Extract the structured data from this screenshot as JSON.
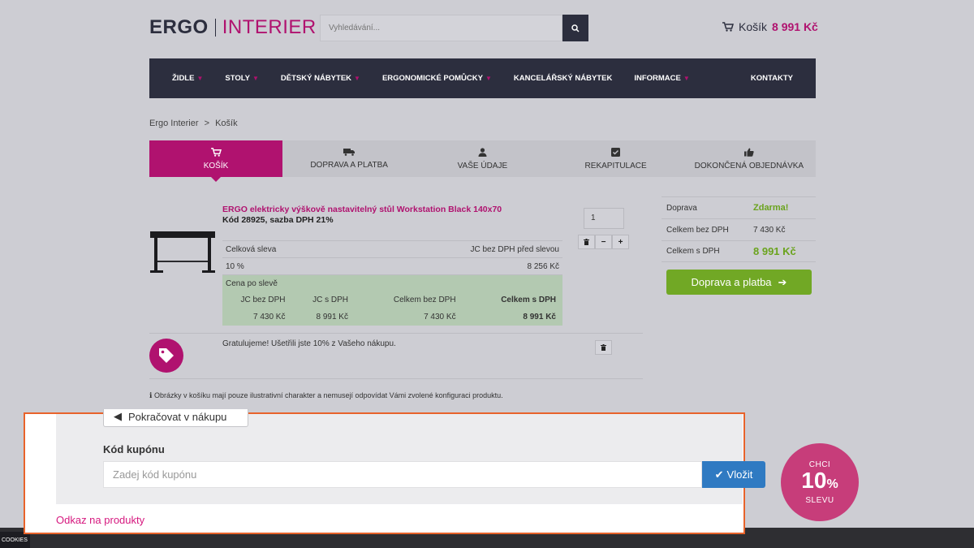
{
  "header": {
    "logo_left": "ERGO",
    "logo_right": "INTERIER",
    "search_placeholder": "Vyhledávání...",
    "cart_label": "Košík",
    "cart_amount": "8 991 Kč"
  },
  "nav": {
    "items": [
      "ŽIDLE",
      "STOLY",
      "DĚTSKÝ NÁBYTEK",
      "ERGONOMICKÉ POMŮCKY",
      "KANCELÁŘSKÝ NÁBYTEK",
      "INFORMACE",
      "KONTAKTY"
    ]
  },
  "breadcrumb": {
    "home": "Ergo Interier",
    "sep": ">",
    "current": "Košík"
  },
  "steps": [
    "KOŠÍK",
    "DOPRAVA A PLATBA",
    "VAŠE ÚDAJE",
    "REKAPITULACE",
    "DOKONČENÁ OBJEDNÁVKA"
  ],
  "product": {
    "title": "ERGO elektricky výškově nastavitelný stůl Workstation Black 140x70",
    "code": "Kód 28925, sazba DPH 21%",
    "quantity": "1",
    "discount_label": "Celková sleva",
    "price_before_label": "JC bez DPH před slevou",
    "discount_value": "10 %",
    "price_before_value": "8 256 Kč",
    "after_label": "Cena po slevě",
    "col1": "JC bez DPH",
    "col2": "JC s DPH",
    "col3": "Celkem bez DPH",
    "col4": "Celkem s DPH",
    "val1": "7 430 Kč",
    "val2": "8 991 Kč",
    "val3": "7 430 Kč",
    "val4": "8 991 Kč"
  },
  "coupon_message": "Gratulujeme! Ušetřili jste 10% z Vašeho nákupu.",
  "note": "Obrázky v košíku mají pouze ilustrativní charakter a nemusejí odpovídat Vámi zvolené konfiguraci produktu.",
  "summary": {
    "shipping_label": "Doprava",
    "shipping_value": "Zdarma!",
    "total_excl_label": "Celkem bez DPH",
    "total_excl_value": "7 430 Kč",
    "total_incl_label": "Celkem s DPH",
    "total_incl_value": "8 991 Kč",
    "next_button": "Doprava a platba"
  },
  "popup": {
    "continue_label": "Pokračovat v nákupu",
    "coupon_label": "Kód kupónu",
    "coupon_placeholder": "Zadej kód kupónu",
    "apply_label": "Vložit",
    "products_link": "Odkaz na produkty"
  },
  "promo": {
    "line1": "CHCI",
    "line2": "10",
    "percent": "%",
    "line3": "SLEVU"
  },
  "cookies": "COOKIES",
  "colors": {
    "brand": "#b0126f",
    "nav": "#2c2e3e",
    "green": "#71a825",
    "blue": "#2f7ac2",
    "highlight": "#e8632b"
  }
}
